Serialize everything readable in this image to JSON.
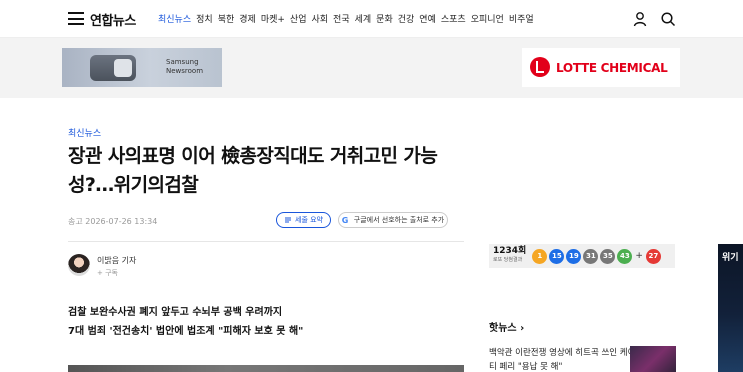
{
  "header": {
    "logo": "연합뉴스",
    "nav": [
      "최신뉴스",
      "정치",
      "북한",
      "경제",
      "마켓+",
      "산업",
      "사회",
      "전국",
      "세계",
      "문화",
      "건강",
      "연예",
      "스포츠",
      "오피니언",
      "비주얼"
    ]
  },
  "ads": {
    "samsung": "Samsung Newsroom",
    "lotte": "LOTTE CHEMICAL"
  },
  "article": {
    "section": "최신뉴스",
    "headline": "장관 사의표명 이어 檢총장직대도 거취고민 가능성?…위기의검찰",
    "timestamp": "송고 2026-07-26 13:34",
    "summary_button": "세줄 요약",
    "google_button": "구글에서 선호하는 출처로 추가",
    "reporter": "이밝음 기자",
    "subscribe": "+ 구독",
    "summary_lines": [
      "검찰 보완수사권 폐지 앞두고 수뇌부 공백 우려까지",
      "7대 범죄 '전건송치' 법안에 법조계 \"피해자 보호 못 해\""
    ]
  },
  "lotto": {
    "round": "1234회",
    "round_sub": "로또 당첨결과",
    "numbers": [
      1,
      15,
      19,
      31,
      35,
      43
    ],
    "bonus": 27,
    "colors": [
      "#f5a623",
      "#1e6ee6",
      "#1e6ee6",
      "#777777",
      "#777777",
      "#4caf50",
      "#e53935"
    ]
  },
  "hot": {
    "title": "핫뉴스",
    "item": "백악관 이란전쟁 영상에 히트곡 쓰인 케이티 페리 \"용납 못 해\""
  },
  "side_ad": {
    "text": "위기"
  }
}
